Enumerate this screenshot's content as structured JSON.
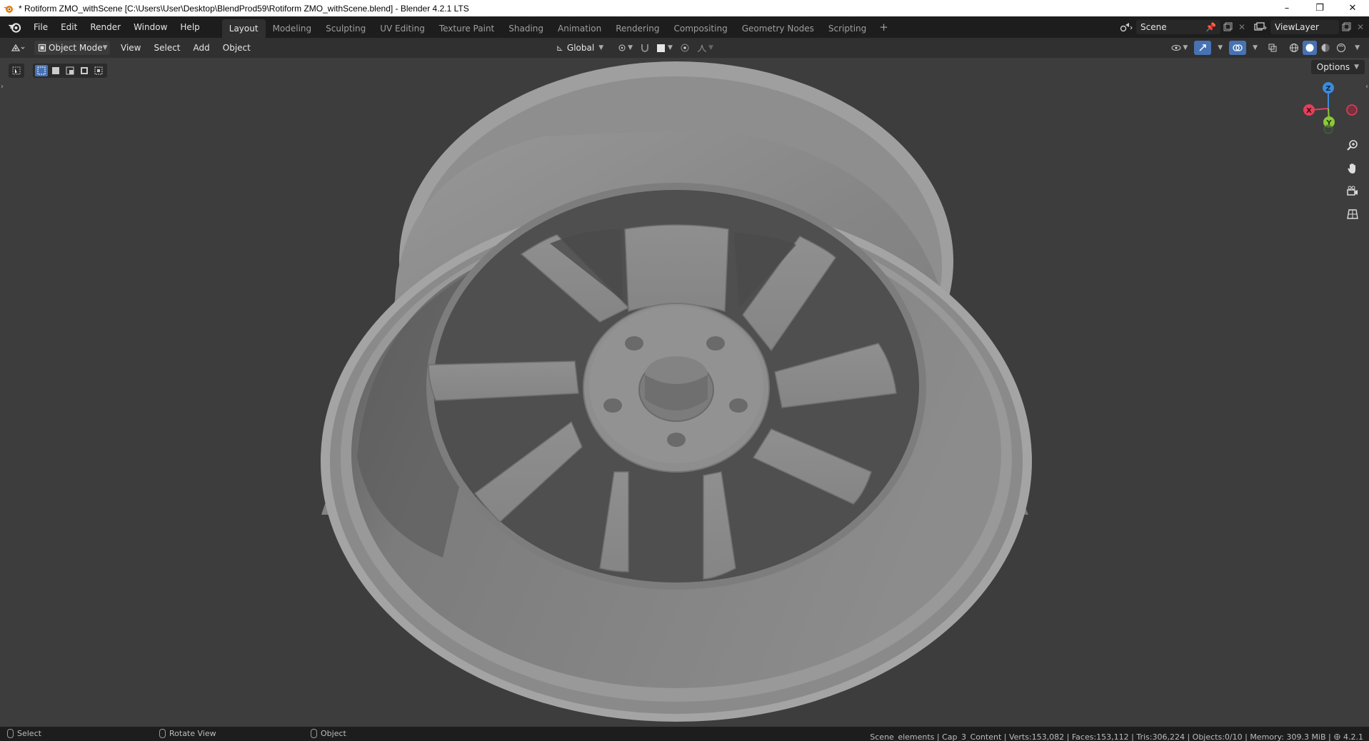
{
  "window": {
    "title": "* Rotiform ZMO_withScene [C:\\Users\\User\\Desktop\\BlendProd59\\Rotiform ZMO_withScene.blend] - Blender 4.2.1 LTS",
    "minimize": "–",
    "restore": "❐",
    "close": "✕"
  },
  "menu": [
    "File",
    "Edit",
    "Render",
    "Window",
    "Help"
  ],
  "workspaces": {
    "tabs": [
      "Layout",
      "Modeling",
      "Sculpting",
      "UV Editing",
      "Texture Paint",
      "Shading",
      "Animation",
      "Rendering",
      "Compositing",
      "Geometry Nodes",
      "Scripting"
    ],
    "active": "Layout",
    "add": "+"
  },
  "scene": {
    "name": "Scene",
    "view_layer": "ViewLayer"
  },
  "viewport_header": {
    "mode": "Object Mode",
    "menus": [
      "View",
      "Select",
      "Add",
      "Object"
    ],
    "transform_orientation": "Global"
  },
  "viewport": {
    "options_label": "Options",
    "gizmo": {
      "x": "X",
      "y": "Y",
      "z": "Z"
    }
  },
  "status": {
    "hint_select": "Select",
    "hint_rotate": "Rotate View",
    "hint_object": "Object",
    "stats": "Scene_elements | Cap_3_Content | Verts:153,082 | Faces:153,112 | Tris:306,224 | Objects:0/10 | Memory: 309.3 MiB |",
    "version": "4.2.1"
  },
  "colors": {
    "axis_x": "#e2405a",
    "axis_y": "#8bc83a",
    "axis_z": "#3d8bda",
    "accent": "#4772b3"
  }
}
